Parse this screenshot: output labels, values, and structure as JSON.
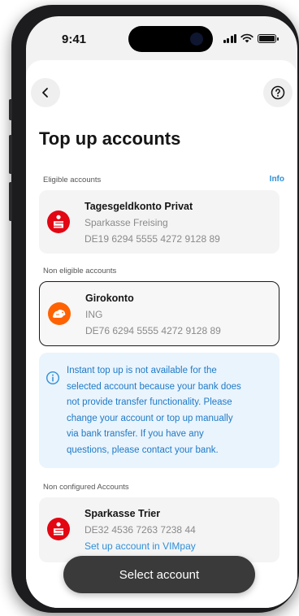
{
  "status_bar": {
    "time": "9:41",
    "icons": [
      "signal-icon",
      "wifi-icon",
      "battery-icon"
    ]
  },
  "nav": {
    "back_icon": "chevron-left-icon",
    "help_icon": "question-circle-icon"
  },
  "page": {
    "title": "Top up accounts"
  },
  "eligible": {
    "label": "Eligible accounts",
    "info_link": "Info",
    "accounts": [
      {
        "name": "Tagesgeldkonto Privat",
        "bank": "Sparkasse Freising",
        "iban": "DE19 6294 5555 4272 9128 89",
        "logo": "sparkasse-logo-icon"
      }
    ]
  },
  "non_eligible": {
    "label": "Non eligible accounts",
    "accounts": [
      {
        "name": "Girokonto",
        "bank": "ING",
        "iban": "DE76 6294 5555 4272 9128 89",
        "logo": "ing-lion-logo-icon",
        "selected": true
      }
    ]
  },
  "notice": {
    "icon": "info-icon",
    "lines": [
      "Instant top up is not available for the",
      "selected account because your bank does",
      "not provide transfer functionality. Please",
      "change your account or top up manually",
      "via bank transfer. If you have any",
      "questions, please contact your bank."
    ]
  },
  "non_configured": {
    "label": "Non configured Accounts",
    "accounts": [
      {
        "name": "Sparkasse Trier",
        "iban": "DE32 4536 7263 7238 44",
        "action": "Set up account in VIMpay",
        "logo": "sparkasse-logo-icon"
      }
    ]
  },
  "cta": {
    "label": "Select account"
  },
  "colors": {
    "accent": "#2f8fd8",
    "notice_bg": "#eaf4fd",
    "sparkasse_red": "#e30613",
    "ing_orange": "#ff6200",
    "button_bg": "#3a3a3a"
  }
}
